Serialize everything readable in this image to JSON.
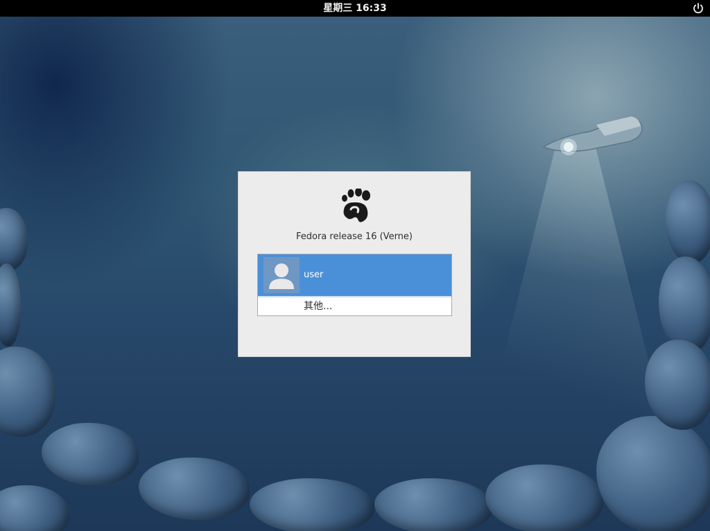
{
  "panel": {
    "clock": "星期三 16:33",
    "power_icon": "power-icon"
  },
  "dialog": {
    "logo_icon": "gnome-foot-icon",
    "distro": "Fedora release 16 (Verne)",
    "users": [
      {
        "name": "user",
        "avatar_icon": "user-avatar-icon",
        "selected": true
      }
    ],
    "other_label": "其他..."
  },
  "colors": {
    "panel_bg": "#000000",
    "dialog_bg": "#ececec",
    "selection": "#4a90d9"
  }
}
